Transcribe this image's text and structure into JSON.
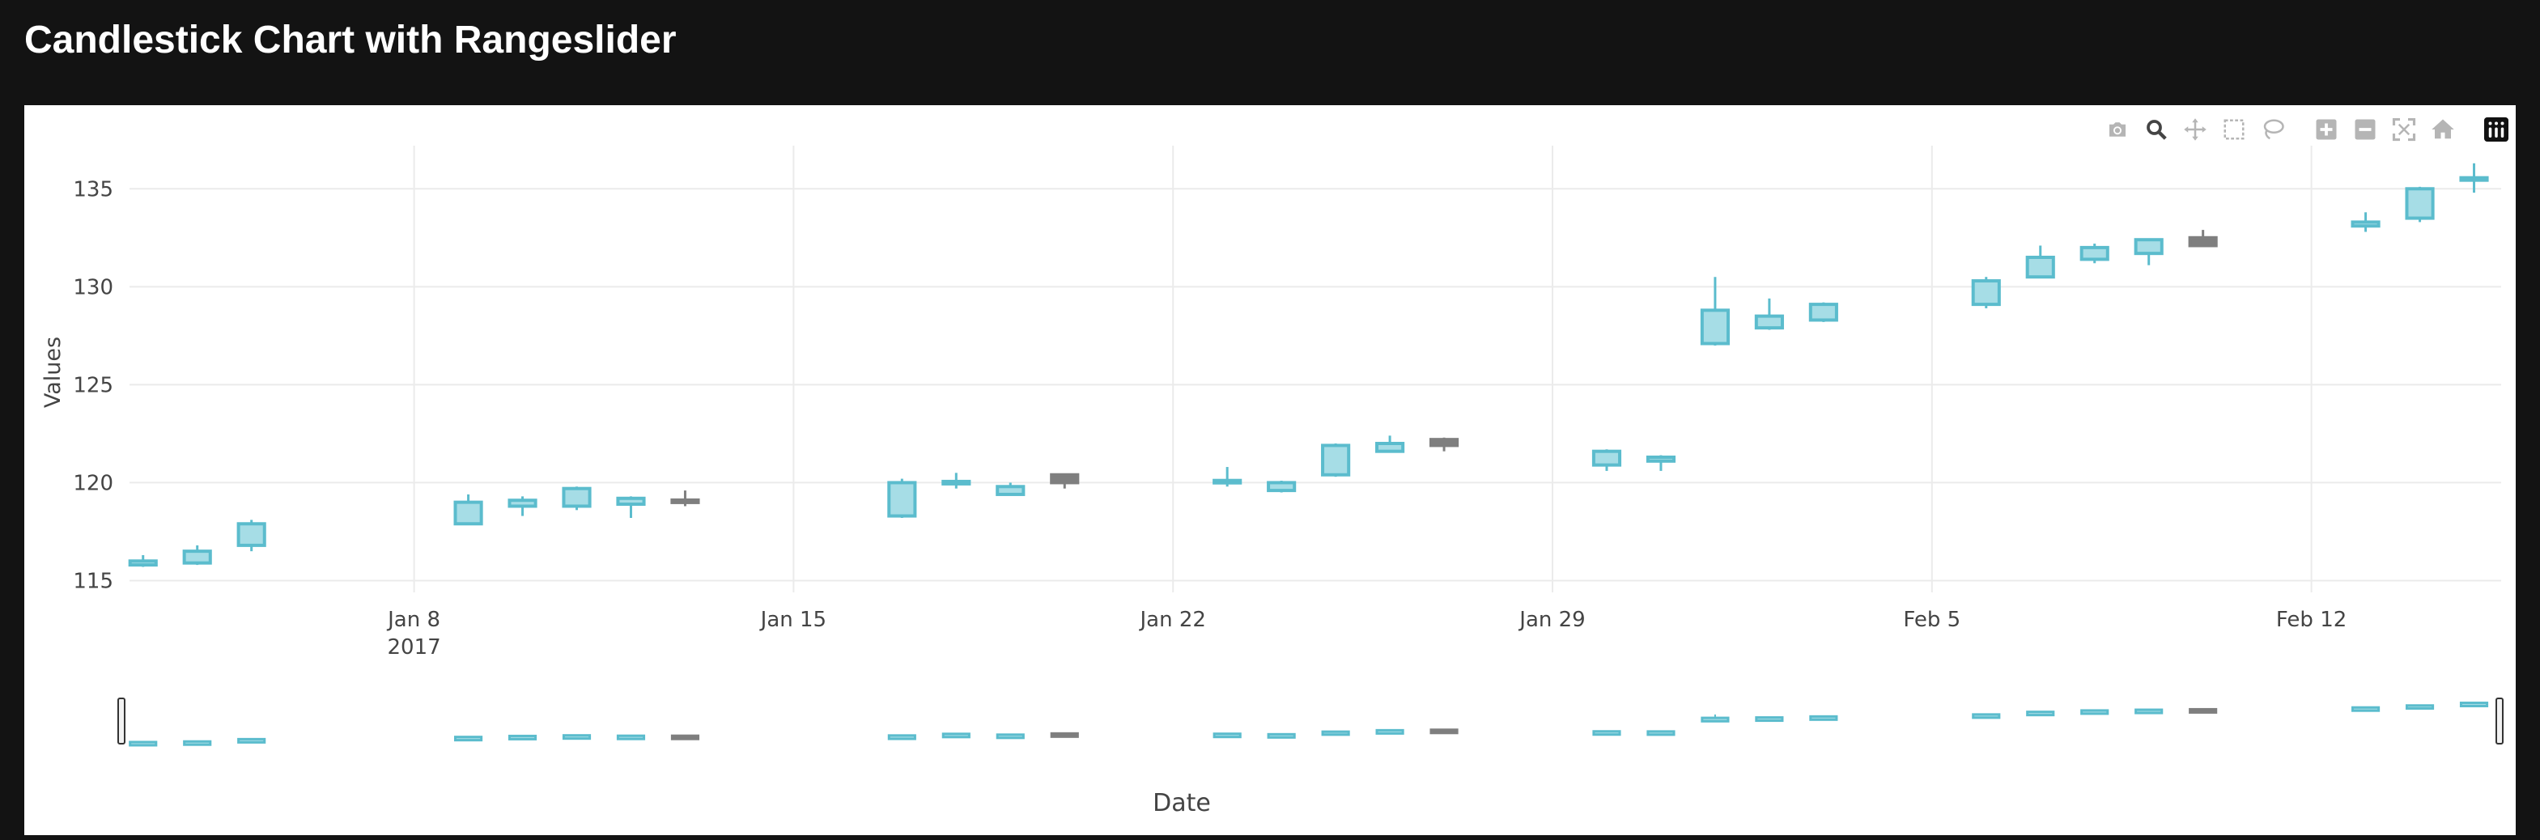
{
  "page": {
    "title": "Candlestick Chart with Rangeslider"
  },
  "modebar": {
    "buttons": [
      {
        "name": "camera-icon",
        "title": "Download plot as a png"
      },
      {
        "name": "zoom-icon",
        "title": "Zoom"
      },
      {
        "name": "pan-icon",
        "title": "Pan"
      },
      {
        "name": "box-select-icon",
        "title": "Box Select"
      },
      {
        "name": "lasso-select-icon",
        "title": "Lasso Select"
      },
      {
        "name": "zoom-in-icon",
        "title": "Zoom in"
      },
      {
        "name": "zoom-out-icon",
        "title": "Zoom out"
      },
      {
        "name": "autoscale-icon",
        "title": "Autoscale"
      },
      {
        "name": "reset-axes-icon",
        "title": "Reset axes"
      },
      {
        "name": "plotly-logo-icon",
        "title": "Produced with Plotly"
      }
    ]
  },
  "chart_data": {
    "type": "candlestick",
    "title": "",
    "xlabel": "Date",
    "ylabel": "Values",
    "ylim": [
      114.4,
      137.2
    ],
    "xlim": [
      "2017-01-02T18:00",
      "2017-02-15T12:00"
    ],
    "yticks": [
      115,
      120,
      125,
      130,
      135
    ],
    "xticks": [
      {
        "date": "2017-01-08",
        "label": "Jan 8",
        "sublabel": "2017"
      },
      {
        "date": "2017-01-15",
        "label": "Jan 15",
        "sublabel": ""
      },
      {
        "date": "2017-01-22",
        "label": "Jan 22",
        "sublabel": ""
      },
      {
        "date": "2017-01-29",
        "label": "Jan 29",
        "sublabel": ""
      },
      {
        "date": "2017-02-05",
        "label": "Feb 5",
        "sublabel": ""
      },
      {
        "date": "2017-02-12",
        "label": "Feb 12",
        "sublabel": ""
      }
    ],
    "grid": true,
    "rangeslider": true,
    "colors": {
      "increasing": "#5bbccd",
      "increasing_fill": "#a6dde6",
      "decreasing": "#7f7f7f",
      "grid": "#ebebeb",
      "axis_text": "#444444"
    },
    "candles": [
      {
        "date": "2017-01-03",
        "open": 115.8,
        "high": 116.3,
        "low": 115.7,
        "close": 116.0
      },
      {
        "date": "2017-01-04",
        "open": 115.9,
        "high": 116.8,
        "low": 115.8,
        "close": 116.5
      },
      {
        "date": "2017-01-05",
        "open": 116.8,
        "high": 118.1,
        "low": 116.5,
        "close": 117.9
      },
      {
        "date": "2017-01-09",
        "open": 117.9,
        "high": 119.4,
        "low": 117.9,
        "close": 119.0
      },
      {
        "date": "2017-01-10",
        "open": 118.8,
        "high": 119.3,
        "low": 118.3,
        "close": 119.1
      },
      {
        "date": "2017-01-11",
        "open": 118.8,
        "high": 119.8,
        "low": 118.6,
        "close": 119.7
      },
      {
        "date": "2017-01-12",
        "open": 118.9,
        "high": 119.3,
        "low": 118.2,
        "close": 119.2
      },
      {
        "date": "2017-01-13",
        "open": 119.1,
        "high": 119.6,
        "low": 118.8,
        "close": 119.0
      },
      {
        "date": "2017-01-17",
        "open": 118.3,
        "high": 120.2,
        "low": 118.2,
        "close": 120.0
      },
      {
        "date": "2017-01-18",
        "open": 120.0,
        "high": 120.5,
        "low": 119.7,
        "close": 120.0
      },
      {
        "date": "2017-01-19",
        "open": 119.4,
        "high": 120.0,
        "low": 119.4,
        "close": 119.8
      },
      {
        "date": "2017-01-20",
        "open": 120.4,
        "high": 120.4,
        "low": 119.7,
        "close": 120.0
      },
      {
        "date": "2017-01-23",
        "open": 120.0,
        "high": 120.8,
        "low": 119.8,
        "close": 120.1
      },
      {
        "date": "2017-01-24",
        "open": 119.6,
        "high": 120.1,
        "low": 119.5,
        "close": 120.0
      },
      {
        "date": "2017-01-25",
        "open": 120.4,
        "high": 122.0,
        "low": 120.3,
        "close": 121.9
      },
      {
        "date": "2017-01-26",
        "open": 121.6,
        "high": 122.4,
        "low": 121.6,
        "close": 122.0
      },
      {
        "date": "2017-01-27",
        "open": 122.2,
        "high": 122.3,
        "low": 121.6,
        "close": 121.9
      },
      {
        "date": "2017-01-30",
        "open": 120.9,
        "high": 121.7,
        "low": 120.6,
        "close": 121.6
      },
      {
        "date": "2017-01-31",
        "open": 121.1,
        "high": 121.4,
        "low": 120.6,
        "close": 121.3
      },
      {
        "date": "2017-02-01",
        "open": 127.1,
        "high": 130.5,
        "low": 127.0,
        "close": 128.8
      },
      {
        "date": "2017-02-02",
        "open": 127.9,
        "high": 129.4,
        "low": 127.8,
        "close": 128.5
      },
      {
        "date": "2017-02-03",
        "open": 128.3,
        "high": 129.2,
        "low": 128.2,
        "close": 129.1
      },
      {
        "date": "2017-02-06",
        "open": 129.1,
        "high": 130.5,
        "low": 128.9,
        "close": 130.3
      },
      {
        "date": "2017-02-07",
        "open": 130.5,
        "high": 132.1,
        "low": 130.5,
        "close": 131.5
      },
      {
        "date": "2017-02-08",
        "open": 131.4,
        "high": 132.2,
        "low": 131.2,
        "close": 132.0
      },
      {
        "date": "2017-02-09",
        "open": 131.7,
        "high": 132.4,
        "low": 131.1,
        "close": 132.4
      },
      {
        "date": "2017-02-10",
        "open": 132.5,
        "high": 132.9,
        "low": 132.1,
        "close": 132.1
      },
      {
        "date": "2017-02-13",
        "open": 133.1,
        "high": 133.8,
        "low": 132.8,
        "close": 133.3
      },
      {
        "date": "2017-02-14",
        "open": 133.5,
        "high": 135.1,
        "low": 133.3,
        "close": 135.0
      },
      {
        "date": "2017-02-15",
        "open": 135.5,
        "high": 136.3,
        "low": 134.8,
        "close": 135.5
      }
    ]
  }
}
